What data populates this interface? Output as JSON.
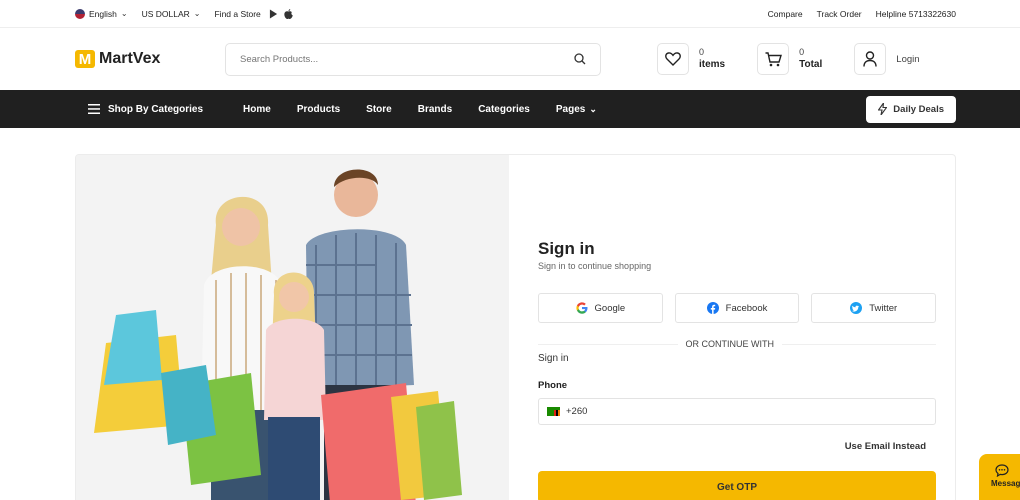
{
  "topbar": {
    "language": "English",
    "currency": "US DOLLAR",
    "find_store": "Find a Store",
    "compare": "Compare",
    "track_order": "Track Order",
    "helpline": "Helpline 5713322630"
  },
  "header": {
    "logo_letter": "M",
    "logo_text": "MartVex",
    "search_placeholder": "Search Products...",
    "wishlist_count": "0",
    "wishlist_label": "items",
    "cart_count": "0",
    "cart_label": "Total",
    "login_label": "Login"
  },
  "nav": {
    "categories_label": "Shop By Categories",
    "links": [
      "Home",
      "Products",
      "Store",
      "Brands",
      "Categories",
      "Pages"
    ],
    "deals_label": "Daily Deals"
  },
  "signin": {
    "title": "Sign in",
    "subtitle": "Sign in to continue shopping",
    "google": "Google",
    "facebook": "Facebook",
    "twitter": "Twitter",
    "divider": "OR CONTINUE WITH",
    "method_label": "Sign in",
    "phone_label": "Phone",
    "phone_value": "+260",
    "alt_link": "Use Email Instead",
    "otp_button": "Get OTP"
  },
  "floating": {
    "message_label": "Messag"
  },
  "colors": {
    "accent": "#f5b800",
    "navbar": "#202020"
  }
}
